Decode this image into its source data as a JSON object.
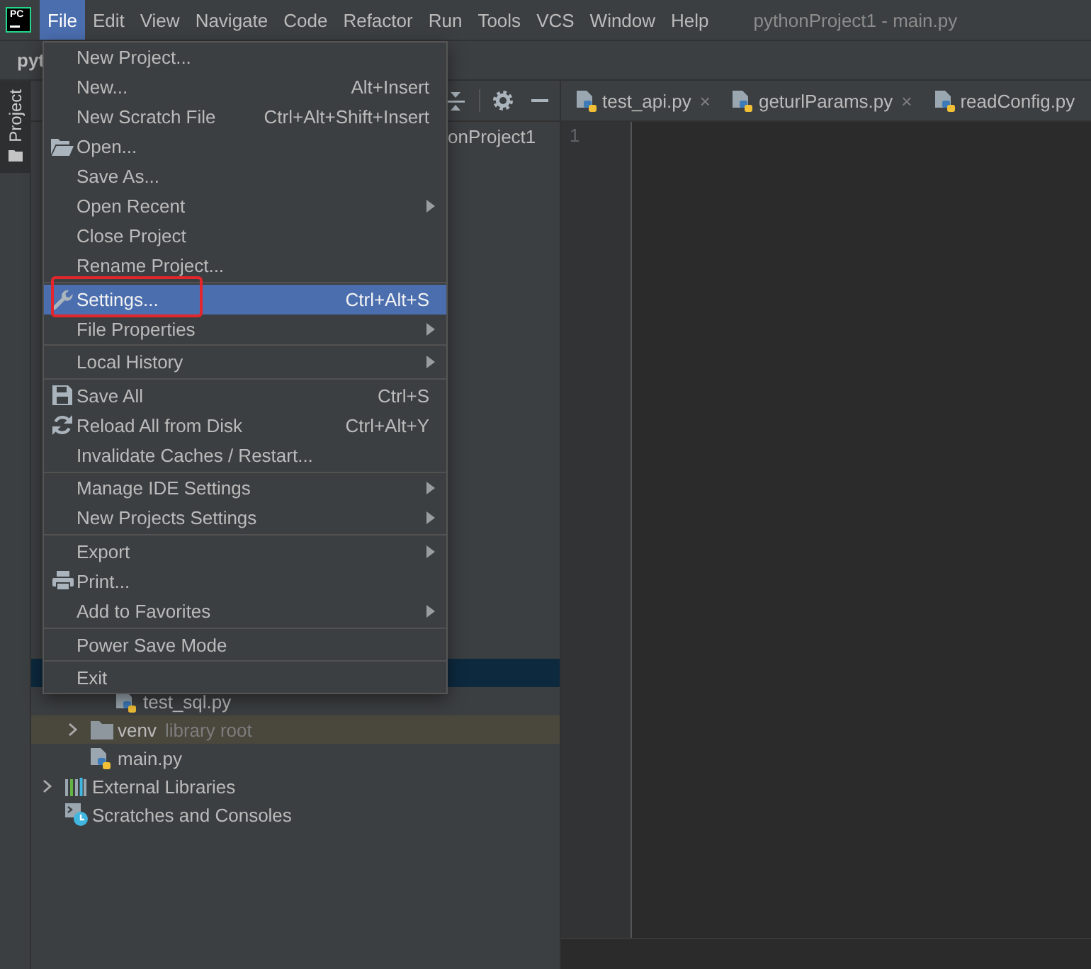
{
  "window": {
    "logo": "PC",
    "title": "pythonProject1 - main.py"
  },
  "menubar": {
    "items": [
      {
        "label": "File",
        "selected": true
      },
      {
        "label": "Edit",
        "selected": false
      },
      {
        "label": "View",
        "selected": false
      },
      {
        "label": "Navigate",
        "selected": false
      },
      {
        "label": "Code",
        "selected": false
      },
      {
        "label": "Refactor",
        "selected": false
      },
      {
        "label": "Run",
        "selected": false
      },
      {
        "label": "Tools",
        "selected": false
      },
      {
        "label": "VCS",
        "selected": false
      },
      {
        "label": "Window",
        "selected": false
      },
      {
        "label": "Help",
        "selected": false
      }
    ]
  },
  "navbar": {
    "breadcrumb": "pyt"
  },
  "tool_strip": {
    "tabs": [
      {
        "label": "Project",
        "selected": true
      }
    ]
  },
  "project_panel": {
    "tree": [
      {
        "label": "onProject1",
        "kind": "project",
        "selected": false,
        "children": [
          {
            "selected": true,
            "children": [
              {
                "label": "test_sql.py",
                "kind": "python",
                "selected": false
              }
            ]
          },
          {
            "label": "venv",
            "note": "library root",
            "kind": "library_root",
            "expanded": false,
            "selected": false
          },
          {
            "label": "main.py",
            "kind": "python",
            "selected": false
          }
        ]
      },
      {
        "label": "External Libraries",
        "kind": "libraries",
        "expanded": false,
        "selected": false
      },
      {
        "label": "Scratches and Consoles",
        "kind": "scratches",
        "selected": false
      }
    ]
  },
  "editor": {
    "tabs": [
      {
        "label": "test_api.py",
        "close": "×",
        "selected": false
      },
      {
        "label": "geturlParams.py",
        "close": "×",
        "selected": false
      },
      {
        "label": "readConfig.py",
        "selected": false
      }
    ],
    "line_numbers": [
      "1"
    ]
  },
  "file_menu": {
    "sections": [
      {
        "items": [
          {
            "label": "New Project...",
            "kind": "plain",
            "submenu": false,
            "selected": false,
            "annotated": false
          },
          {
            "label": "New...",
            "shortcut": "Alt+Insert",
            "kind": "plain",
            "submenu": false,
            "selected": false,
            "annotated": false
          },
          {
            "label": "New Scratch File",
            "shortcut": "Ctrl+Alt+Shift+Insert",
            "kind": "plain",
            "submenu": false,
            "selected": false,
            "annotated": false
          },
          {
            "label": "Open...",
            "kind": "open",
            "submenu": false,
            "selected": false,
            "annotated": false
          },
          {
            "label": "Save As...",
            "kind": "plain",
            "submenu": false,
            "selected": false,
            "annotated": false
          },
          {
            "label": "Open Recent",
            "kind": "plain",
            "submenu": true,
            "selected": false,
            "annotated": false
          },
          {
            "label": "Close Project",
            "kind": "plain",
            "submenu": false,
            "selected": false,
            "annotated": false
          },
          {
            "label": "Rename Project...",
            "kind": "plain",
            "submenu": false,
            "selected": false,
            "annotated": false
          }
        ]
      },
      {
        "items": [
          {
            "label": "Settings...",
            "shortcut": "Ctrl+Alt+S",
            "kind": "settings",
            "submenu": false,
            "selected": true,
            "annotated": true
          },
          {
            "label": "File Properties",
            "kind": "plain",
            "submenu": true,
            "selected": false,
            "annotated": false
          }
        ]
      },
      {
        "items": [
          {
            "label": "Local History",
            "kind": "plain",
            "submenu": true,
            "selected": false,
            "annotated": false
          }
        ]
      },
      {
        "items": [
          {
            "label": "Save All",
            "shortcut": "Ctrl+S",
            "kind": "save",
            "submenu": false,
            "selected": false,
            "annotated": false
          },
          {
            "label": "Reload All from Disk",
            "shortcut": "Ctrl+Alt+Y",
            "kind": "reload",
            "submenu": false,
            "selected": false,
            "annotated": false
          },
          {
            "label": "Invalidate Caches / Restart...",
            "kind": "plain",
            "submenu": false,
            "selected": false,
            "annotated": false
          }
        ]
      },
      {
        "items": [
          {
            "label": "Manage IDE Settings",
            "kind": "plain",
            "submenu": true,
            "selected": false,
            "annotated": false
          },
          {
            "label": "New Projects Settings",
            "kind": "plain",
            "submenu": true,
            "selected": false,
            "annotated": false
          }
        ]
      },
      {
        "items": [
          {
            "label": "Export",
            "kind": "plain",
            "submenu": true,
            "selected": false,
            "annotated": false
          },
          {
            "label": "Print...",
            "kind": "print",
            "submenu": false,
            "selected": false,
            "annotated": false
          },
          {
            "label": "Add to Favorites",
            "kind": "plain",
            "submenu": true,
            "selected": false,
            "annotated": false
          }
        ]
      },
      {
        "items": [
          {
            "label": "Power Save Mode",
            "kind": "plain",
            "submenu": false,
            "selected": false,
            "annotated": false
          }
        ]
      },
      {
        "items": [
          {
            "label": "Exit",
            "kind": "plain",
            "submenu": false,
            "selected": false,
            "annotated": false
          }
        ]
      }
    ]
  }
}
